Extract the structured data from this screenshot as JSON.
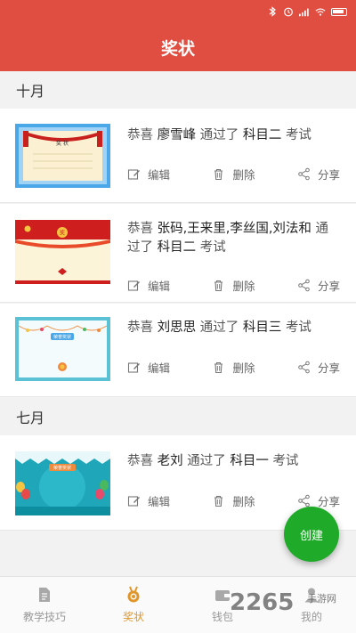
{
  "status_bar": {
    "icons": [
      "bluetooth-icon",
      "alarm-icon",
      "signal-icon",
      "wifi-icon",
      "battery-icon"
    ]
  },
  "header": {
    "title": "奖状"
  },
  "sections": [
    {
      "month": "十月"
    },
    {
      "month": "七月"
    }
  ],
  "cards": [
    {
      "prefix": "恭喜",
      "names": "廖雪峰",
      "mid": "通过了",
      "subject": "科目二",
      "suffix": "考试"
    },
    {
      "prefix": "恭喜",
      "names": "张码,王来里,李丝国,刘法和",
      "mid": "通过了",
      "subject": "科目二",
      "suffix": "考试"
    },
    {
      "prefix": "恭喜",
      "names": "刘思思",
      "mid": "通过了",
      "subject": "科目三",
      "suffix": "考试"
    },
    {
      "prefix": "恭喜",
      "names": "老刘",
      "mid": "通过了",
      "subject": "科目一",
      "suffix": "考试"
    }
  ],
  "actions": {
    "edit": "编辑",
    "delete": "删除",
    "share": "分享"
  },
  "fab": {
    "label": "创建"
  },
  "tabs": [
    {
      "label": "教学技巧",
      "icon": "document-icon",
      "active": false
    },
    {
      "label": "奖状",
      "icon": "medal-icon",
      "active": true
    },
    {
      "label": "钱包",
      "icon": "wallet-icon",
      "active": false
    },
    {
      "label": "我的",
      "icon": "profile-icon",
      "active": false
    }
  ],
  "watermark": {
    "main": "2265",
    "sub": "手游网"
  },
  "colors": {
    "primary": "#e04e42",
    "fab": "#1faa2a",
    "active_tab": "#e0962a"
  }
}
